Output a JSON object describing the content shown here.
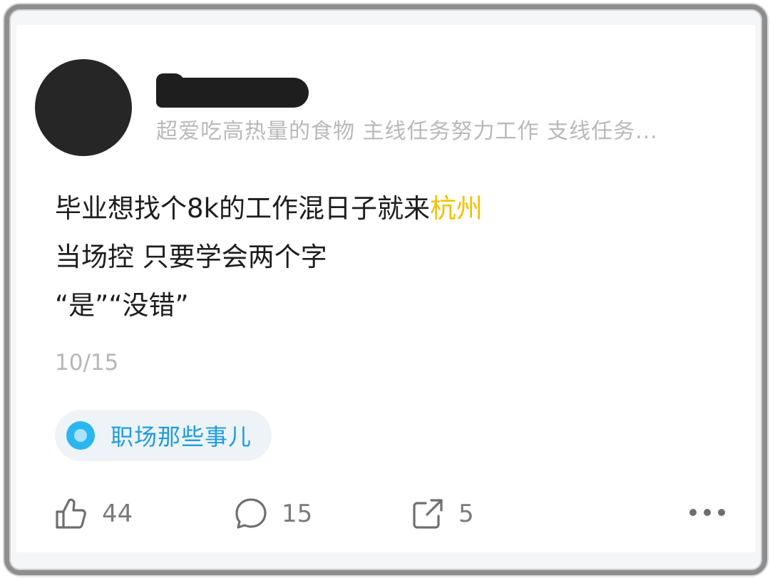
{
  "user": {
    "bio": "超爱吃高热量的食物  主线任务努力工作  支线任务..."
  },
  "post": {
    "line1_a": "毕业想找个8k的工作混日子就来",
    "line1_highlight": "杭州",
    "line2": "当场控 只要学会两个字",
    "line3": "“是”“没错”"
  },
  "date": "10/15",
  "topic": {
    "label": "职场那些事儿",
    "icon": "topic-circle-icon"
  },
  "actions": {
    "like_count": "44",
    "comment_count": "15",
    "share_count": "5"
  },
  "colors": {
    "highlight": "#f2c200",
    "topic_blue": "#1d9ddb"
  }
}
